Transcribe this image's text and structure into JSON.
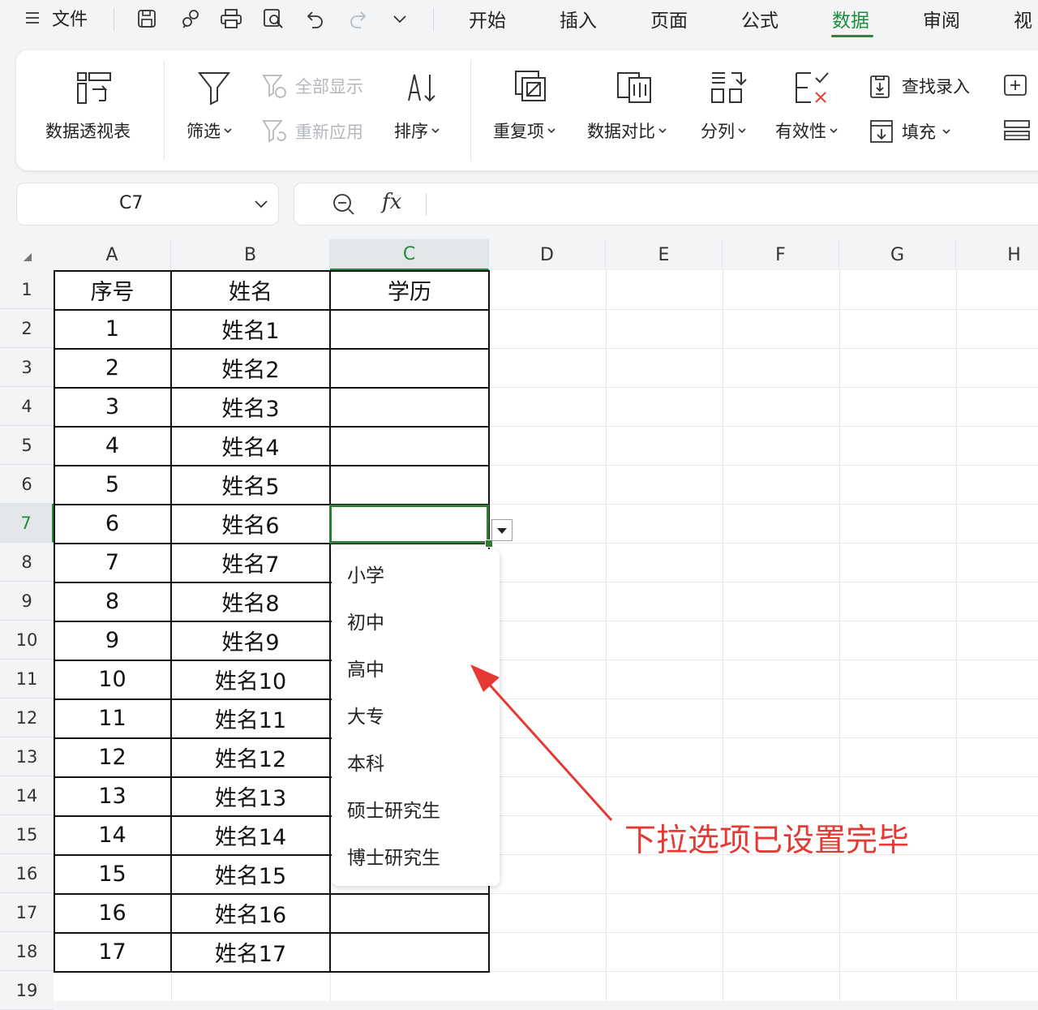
{
  "menubar": {
    "file_label": "文件",
    "tabs": [
      {
        "label": "开始"
      },
      {
        "label": "插入"
      },
      {
        "label": "页面"
      },
      {
        "label": "公式"
      },
      {
        "label": "数据"
      },
      {
        "label": "审阅"
      },
      {
        "label": "视"
      }
    ],
    "active_tab": "数据"
  },
  "ribbon": {
    "pivot_table": "数据透视表",
    "filter": "筛选",
    "show_all": "全部显示",
    "reapply": "重新应用",
    "sort": "排序",
    "duplicates": "重复项",
    "compare": "数据对比",
    "split": "分列",
    "validity": "有效性",
    "find_entry": "查找录入",
    "fill": "填充"
  },
  "formula_bar": {
    "cell_ref": "C7",
    "fx_label": "fx",
    "content": ""
  },
  "grid": {
    "columns": [
      "A",
      "B",
      "C",
      "D",
      "E",
      "F",
      "G",
      "H"
    ],
    "selected_column": "C",
    "rows": [
      "1",
      "2",
      "3",
      "4",
      "5",
      "6",
      "7",
      "8",
      "9",
      "10",
      "11",
      "12",
      "13",
      "14",
      "15",
      "16",
      "17",
      "18",
      "19"
    ],
    "selected_row": "7",
    "header": {
      "a": "序号",
      "b": "姓名",
      "c": "学历"
    },
    "data": [
      {
        "a": "1",
        "b": "姓名1"
      },
      {
        "a": "2",
        "b": "姓名2"
      },
      {
        "a": "3",
        "b": "姓名3"
      },
      {
        "a": "4",
        "b": "姓名4"
      },
      {
        "a": "5",
        "b": "姓名5"
      },
      {
        "a": "6",
        "b": "姓名6"
      },
      {
        "a": "7",
        "b": "姓名7"
      },
      {
        "a": "8",
        "b": "姓名8"
      },
      {
        "a": "9",
        "b": "姓名9"
      },
      {
        "a": "10",
        "b": "姓名10"
      },
      {
        "a": "11",
        "b": "姓名11"
      },
      {
        "a": "12",
        "b": "姓名12"
      },
      {
        "a": "13",
        "b": "姓名13"
      },
      {
        "a": "14",
        "b": "姓名14"
      },
      {
        "a": "15",
        "b": "姓名15"
      },
      {
        "a": "16",
        "b": "姓名16"
      },
      {
        "a": "17",
        "b": "姓名17"
      }
    ]
  },
  "dropdown": {
    "options": [
      "小学",
      "初中",
      "高中",
      "大专",
      "本科",
      "硕士研究生",
      "博士研究生"
    ]
  },
  "annotation": {
    "text": "下拉选项已设置完毕",
    "color": "#e53935"
  },
  "colors": {
    "accent": "#1e8e3e",
    "selection_border": "#2e7d32",
    "background": "#f3f4f6"
  }
}
